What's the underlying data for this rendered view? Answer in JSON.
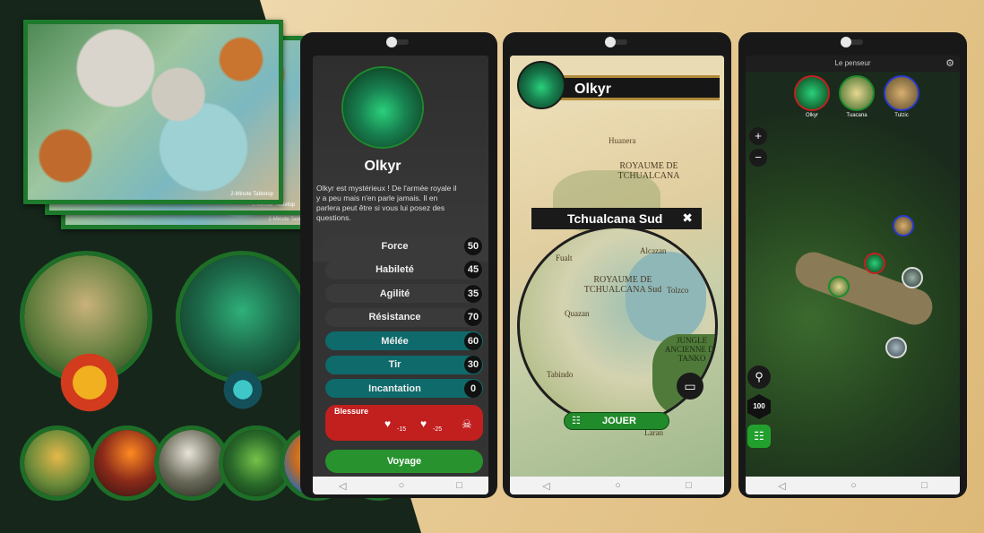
{
  "colors": {
    "accent": "#1f8a2c",
    "parchment": "#e8cc98",
    "dark": "#16261b",
    "teal": "#0f6a6b",
    "red": "#c02020"
  },
  "map_cards": {
    "credit_1": "2-Minute Tabletop",
    "credit_2": "2-Minute Tabletop",
    "credit_3": "2-Minute Tabletop"
  },
  "character_sheet": {
    "name": "Olkyr",
    "description": "Olkyr est mystérieux ! De l'armée royale il y a peu mais n'en parle jamais. Il en parlera peut être si vous lui posez des questions.",
    "stats": [
      {
        "label": "Force",
        "value": "50"
      },
      {
        "label": "Habileté",
        "value": "45"
      },
      {
        "label": "Agilité",
        "value": "35"
      },
      {
        "label": "Résistance",
        "value": "70"
      },
      {
        "label": "Mélée",
        "value": "60"
      },
      {
        "label": "Tir",
        "value": "30"
      },
      {
        "label": "Incantation",
        "value": "0"
      }
    ],
    "wound_label": "Blessure",
    "wound_values": [
      "-15",
      "-25"
    ],
    "action_label": "Voyage"
  },
  "map_screen": {
    "player_name": "Olkyr",
    "region_title": "Tchualcana Sud",
    "close_glyph": "✖",
    "places": [
      "Huanera",
      "ROYAUME DE TCHUALCANA",
      "ROYAUME DE TCHUALCANA Sud",
      "Fualt",
      "Alcazan",
      "Quazan",
      "Tolzco",
      "JUNGLE ANCIENNE DE TANKO",
      "Tabindo",
      "Laran"
    ],
    "play_label": "JOUER"
  },
  "session_screen": {
    "title": "Le penseur",
    "players": [
      {
        "name": "Olkyr"
      },
      {
        "name": "Tuacana"
      },
      {
        "name": "Tulzic"
      }
    ],
    "side_buttons": {
      "zoom_in": "+",
      "zoom_out": "−",
      "level": "100"
    }
  },
  "navbar": {
    "back": "◁",
    "home": "○",
    "recent": "□"
  }
}
